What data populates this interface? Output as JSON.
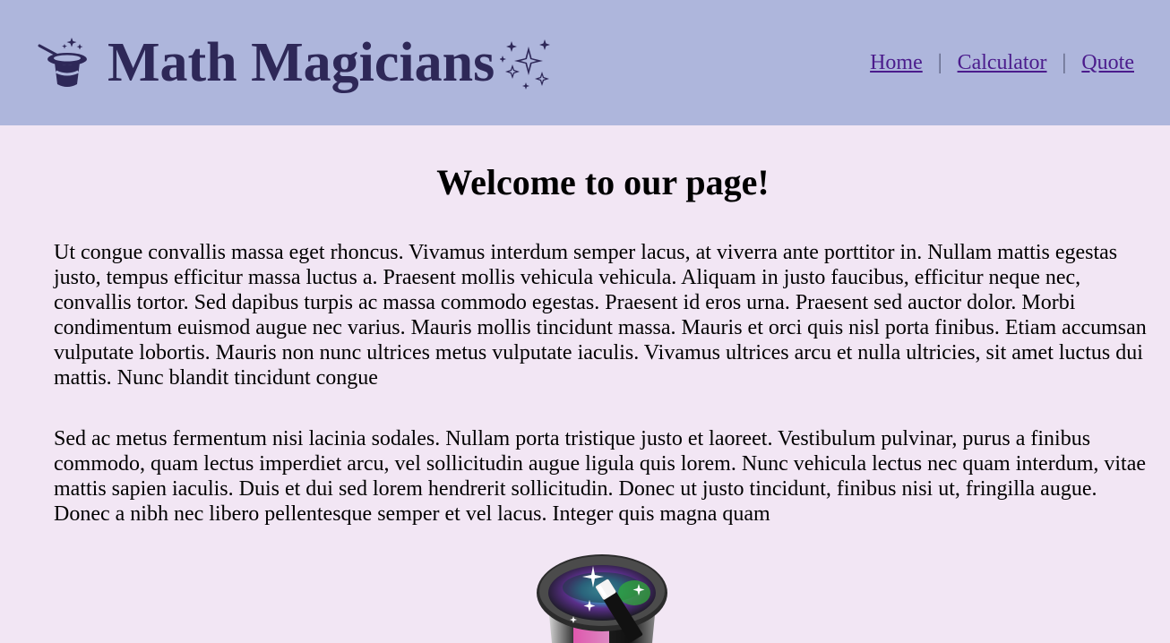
{
  "header": {
    "title": "Math Magicians",
    "logo_icon": "magic-hat-wand-icon",
    "decor_icon": "sparkles-icon",
    "nav": [
      {
        "label": "Home"
      },
      {
        "label": "Calculator"
      },
      {
        "label": "Quote"
      }
    ],
    "nav_separator": "|"
  },
  "main": {
    "heading": "Welcome to our page!",
    "paragraphs": [
      "Ut congue convallis massa eget rhoncus. Vivamus interdum semper lacus, at viverra ante porttitor in. Nullam mattis egestas justo, tempus efficitur massa luctus a. Praesent mollis vehicula vehicula. Aliquam in justo faucibus, efficitur neque nec, convallis tortor. Sed dapibus turpis ac massa commodo egestas. Praesent id eros urna. Praesent sed auctor dolor. Morbi condimentum euismod augue nec varius. Mauris mollis tincidunt massa. Mauris et orci quis nisl porta finibus. Etiam accumsan vulputate lobortis. Mauris non nunc ultrices metus vulputate iaculis. Vivamus ultrices arcu et nulla ultricies, sit amet luctus dui mattis. Nunc blandit tincidunt congue",
      "Sed ac metus fermentum nisi lacinia sodales. Nullam porta tristique justo et laoreet. Vestibulum pulvinar, purus a finibus commodo, quam lectus imperdiet arcu, vel sollicitudin augue ligula quis lorem. Nunc vehicula lectus nec quam interdum, vitae mattis sapien iaculis. Duis et dui sed lorem hendrerit sollicitudin. Donec ut justo tincidunt, finibus nisi ut, fringilla augue. Donec a nibh nec libero pellentesque semper et vel lacus. Integer quis magna quam"
    ],
    "hero_icon": "magic-top-hat-icon"
  },
  "colors": {
    "header_bg": "#aeb6dc",
    "page_bg": "#f2e6f4",
    "title": "#2e2858",
    "link": "#4b1c8c"
  }
}
